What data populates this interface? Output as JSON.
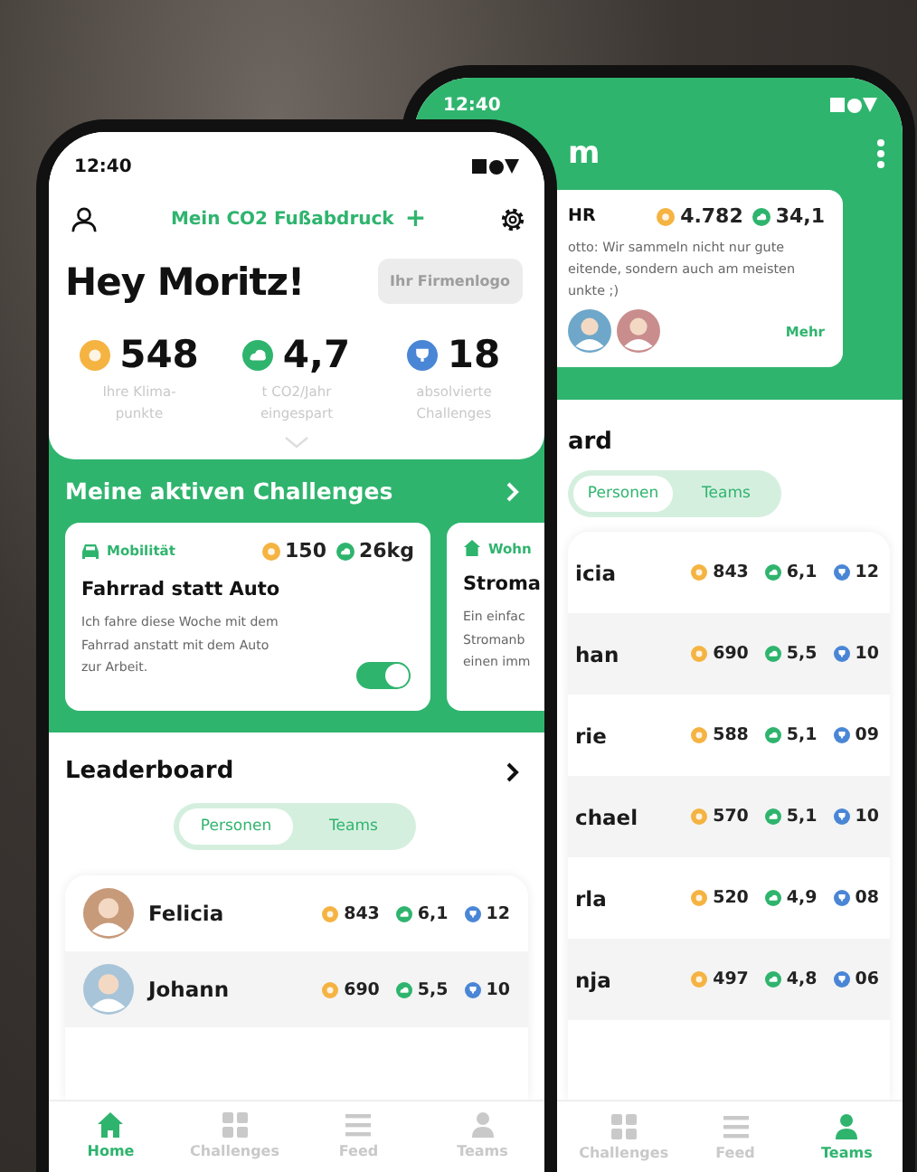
{
  "back_screen": {
    "status_bar": {
      "time": "12:40"
    },
    "title": "m",
    "team_card": {
      "name": "HR",
      "points": "4.782",
      "co2": "34,1",
      "lines": [
        "otto: Wir sammeln nicht nur gute",
        "eitende, sondern auch am meisten",
        "unkte ;)"
      ],
      "link": "Mehr"
    },
    "leaderboard": {
      "title": "ard",
      "segments": [
        {
          "label": "Personen",
          "selected": true
        },
        {
          "label": "Teams",
          "selected": false
        }
      ],
      "rows": [
        {
          "name": "icia",
          "points": "843",
          "co2": "6,1",
          "challenges": "12"
        },
        {
          "name": "han",
          "points": "690",
          "co2": "5,5",
          "challenges": "10"
        },
        {
          "name": "rie",
          "points": "588",
          "co2": "5,1",
          "challenges": "09"
        },
        {
          "name": "chael",
          "points": "570",
          "co2": "5,1",
          "challenges": "10"
        },
        {
          "name": "rla",
          "points": "520",
          "co2": "4,9",
          "challenges": "08"
        },
        {
          "name": "nja",
          "points": "497",
          "co2": "4,8",
          "challenges": "06"
        }
      ]
    },
    "nav": [
      {
        "label": "Challenges",
        "kind": "grid",
        "selected": false
      },
      {
        "label": "Feed",
        "kind": "list",
        "selected": false
      },
      {
        "label": "Teams",
        "kind": "person",
        "selected": true
      }
    ]
  },
  "front_screen": {
    "status_bar": {
      "time": "12:40"
    },
    "top_bar": {
      "title": "Mein CO2 Fußabdruck",
      "action": "+"
    },
    "greeting": "Hey Moritz!",
    "logo_placeholder": "Ihr Firmenlogo",
    "stats": [
      {
        "kind": "points",
        "value": "548",
        "label": "Ihre Klima-punkte"
      },
      {
        "kind": "co2",
        "value": "4,7",
        "label": "t CO2/Jahr eingespart"
      },
      {
        "kind": "challenges",
        "value": "18",
        "label": "absolvierte Challenges"
      }
    ],
    "challenges_section": {
      "title": "Meine aktiven Challenges",
      "cards": [
        {
          "kind": "car",
          "category": "Mobilität",
          "points": "150",
          "co2": "26kg",
          "title": "Fahrrad statt Auto",
          "lines": [
            "Ich fahre diese Woche mit dem",
            "Fahrrad anstatt mit dem Auto",
            "zur Arbeit."
          ],
          "active": true
        },
        {
          "kind": "house",
          "category": "Wohn",
          "title": "Stroma",
          "lines": [
            "Ein einfac",
            "Stromanb",
            "einen imm"
          ]
        }
      ]
    },
    "leaderboard": {
      "title": "Leaderboard",
      "segments": [
        {
          "label": "Personen",
          "selected": true
        },
        {
          "label": "Teams",
          "selected": false
        }
      ],
      "rows": [
        {
          "name": "Felicia",
          "points": "843",
          "co2": "6,1",
          "challenges": "12"
        },
        {
          "name": "Johann",
          "points": "690",
          "co2": "5,5",
          "challenges": "10"
        }
      ]
    },
    "nav": [
      {
        "label": "Home",
        "kind": "home",
        "selected": true
      },
      {
        "label": "Challenges",
        "kind": "grid",
        "selected": false
      },
      {
        "label": "Feed",
        "kind": "list",
        "selected": false
      },
      {
        "label": "Teams",
        "kind": "person",
        "selected": false
      }
    ]
  }
}
